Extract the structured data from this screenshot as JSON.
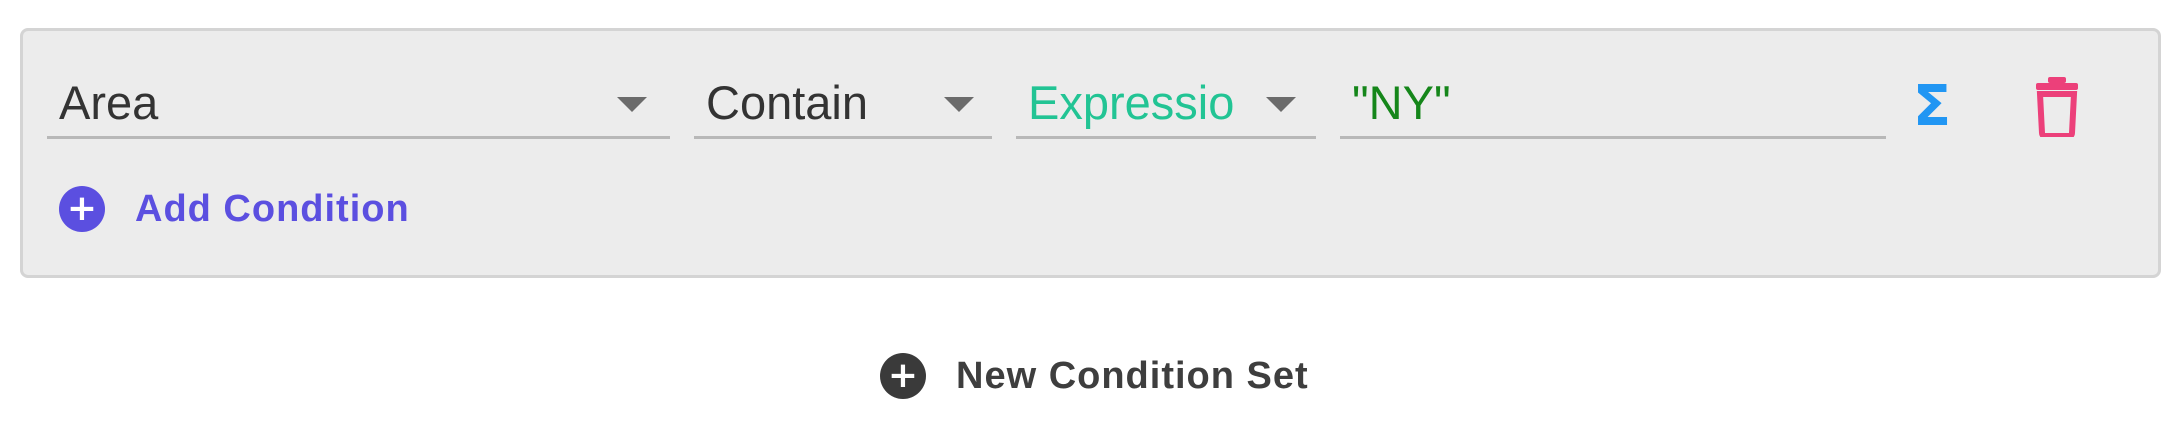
{
  "condition": {
    "field": "Area",
    "operator": "Contain",
    "value_type": "Expressio",
    "value": "\"NY\""
  },
  "actions": {
    "sigma_symbol": "Σ",
    "expression_icon": "sigma-icon",
    "delete_icon": "trash-icon"
  },
  "add_condition": {
    "icon": "plus-circle-icon",
    "label": "Add Condition"
  },
  "new_condition_set": {
    "icon": "plus-circle-icon",
    "label": "New Condition Set"
  },
  "colors": {
    "accent": "#5b4fe0",
    "expression_green": "#22c494",
    "value_green": "#15861a",
    "sigma_blue": "#2196f3",
    "delete_pink": "#ec407a",
    "panel_bg": "#ececec"
  }
}
